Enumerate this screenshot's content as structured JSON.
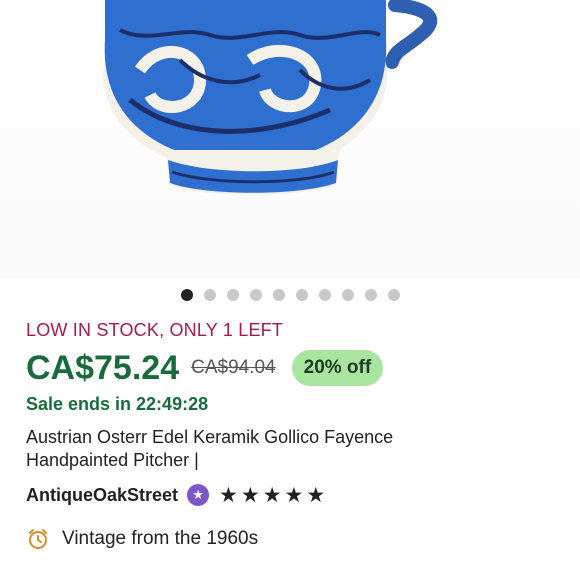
{
  "gallery": {
    "image_alt": "Blue and white handpainted ceramic pitcher",
    "dot_count": 10,
    "active_index": 0
  },
  "listing": {
    "stock_notice": "LOW IN STOCK, ONLY 1 LEFT",
    "price": "CA$75.24",
    "original_price": "CA$94.04",
    "discount": "20% off",
    "sale_timer": "Sale ends in 22:49:28",
    "title_line1": "Austrian Osterr Edel Keramik Gollico Fayence",
    "title_line2": "Handpainted Pitcher |"
  },
  "shop": {
    "name": "AntiqueOakStreet",
    "badge_icon": "star-badge-icon",
    "rating_stars": 5
  },
  "details": {
    "vintage": "Vintage from the 1960s",
    "icon": "alarm-clock-icon"
  },
  "colors": {
    "stock": "#a61a4b",
    "price": "#1a6b3c",
    "discount_bg": "#a8e6a0",
    "badge": "#7f56c6"
  }
}
